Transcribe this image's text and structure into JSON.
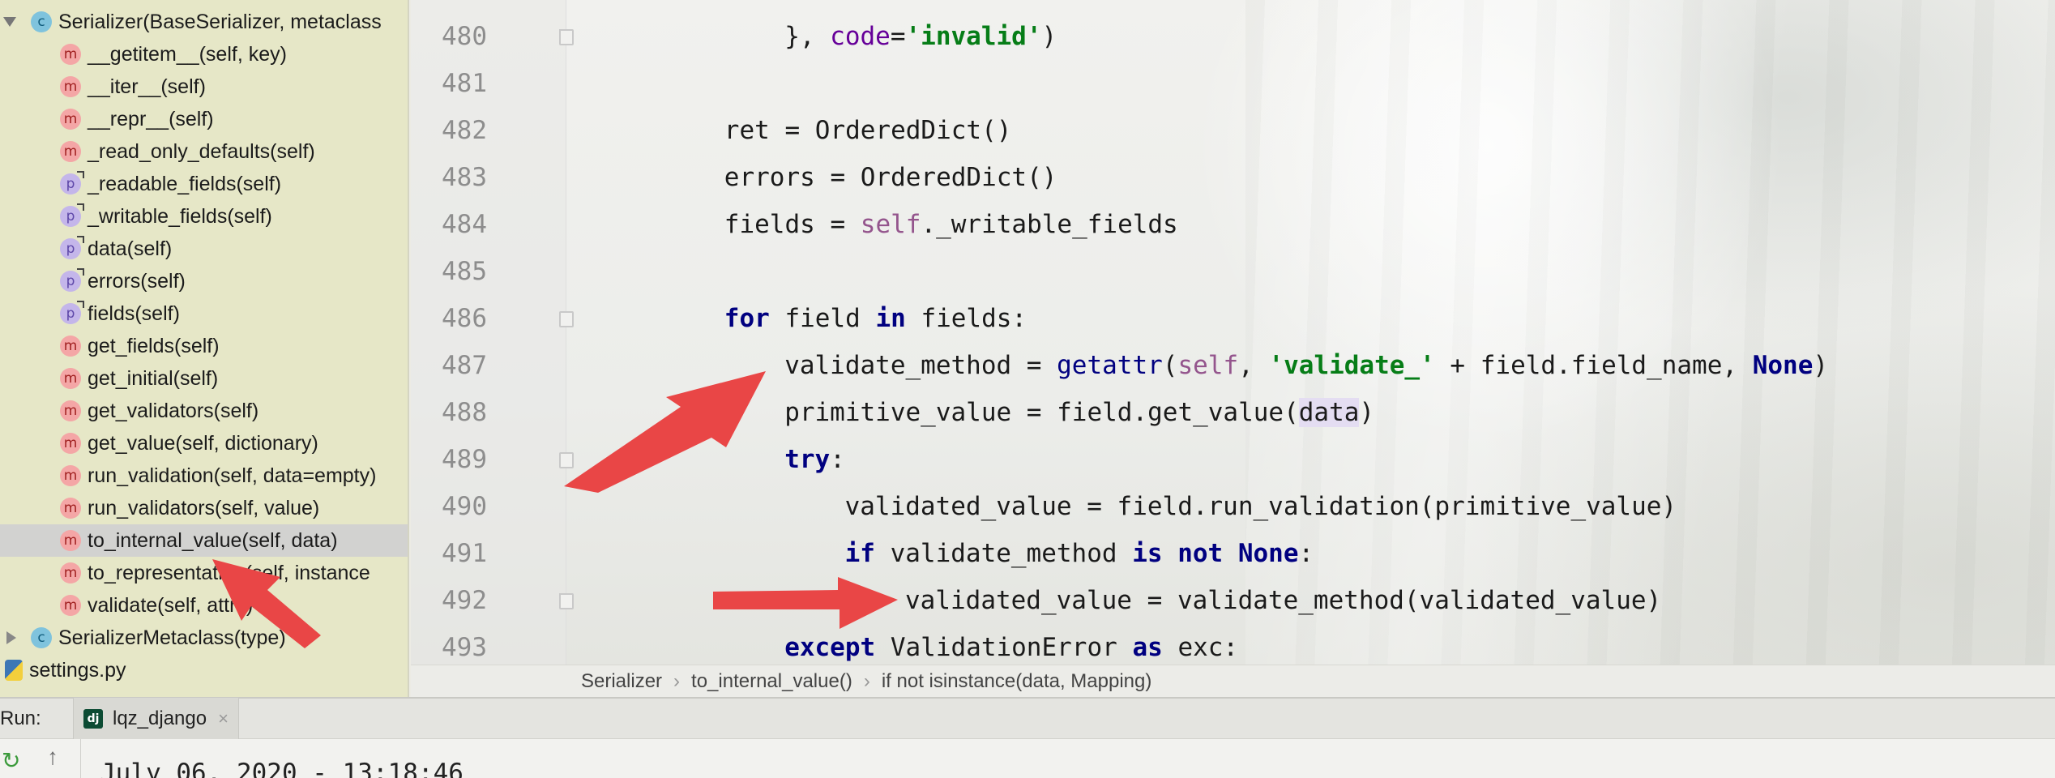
{
  "structure": {
    "items": [
      {
        "kind": "c",
        "label": "Serializer(BaseSerializer, metaclass",
        "expand": "down",
        "indent": 0
      },
      {
        "kind": "m",
        "label": "__getitem__(self, key)",
        "indent": 1
      },
      {
        "kind": "m",
        "label": "__iter__(self)",
        "indent": 1
      },
      {
        "kind": "m",
        "label": "__repr__(self)",
        "indent": 1
      },
      {
        "kind": "m",
        "label": "_read_only_defaults(self)",
        "indent": 1
      },
      {
        "kind": "p",
        "label": "_readable_fields(self)",
        "indent": 1
      },
      {
        "kind": "p",
        "label": "_writable_fields(self)",
        "indent": 1
      },
      {
        "kind": "p",
        "label": "data(self)",
        "indent": 1
      },
      {
        "kind": "p",
        "label": "errors(self)",
        "indent": 1
      },
      {
        "kind": "p",
        "label": "fields(self)",
        "indent": 1
      },
      {
        "kind": "m",
        "label": "get_fields(self)",
        "indent": 1
      },
      {
        "kind": "m",
        "label": "get_initial(self)",
        "indent": 1
      },
      {
        "kind": "m",
        "label": "get_validators(self)",
        "indent": 1
      },
      {
        "kind": "m",
        "label": "get_value(self, dictionary)",
        "indent": 1
      },
      {
        "kind": "m",
        "label": "run_validation(self, data=empty)",
        "indent": 1
      },
      {
        "kind": "m",
        "label": "run_validators(self, value)",
        "indent": 1
      },
      {
        "kind": "m",
        "label": "to_internal_value(self, data)",
        "indent": 1,
        "selected": true
      },
      {
        "kind": "m",
        "label": "to_representation(self, instance",
        "indent": 1
      },
      {
        "kind": "m",
        "label": "validate(self, attrs)",
        "indent": 1
      },
      {
        "kind": "c",
        "label": "SerializerMetaclass(type)",
        "expand": "right",
        "indent": 0
      },
      {
        "kind": "file",
        "label": "settings.py",
        "indent": -1
      }
    ]
  },
  "badge_letters": {
    "m": "m",
    "p": "p",
    "c": "c"
  },
  "editor": {
    "lines": [
      {
        "n": "480",
        "fold": "up",
        "indent": 6,
        "tokens": [
          [
            "}, ",
            ""
          ],
          [
            "code",
            "kwarg"
          ],
          [
            "=",
            ""
          ],
          [
            "'invalid'",
            "str"
          ],
          [
            ")",
            ""
          ]
        ]
      },
      {
        "n": "481",
        "indent": 0,
        "tokens": []
      },
      {
        "n": "482",
        "indent": 4,
        "tokens": [
          [
            "ret = OrderedDict()",
            ""
          ]
        ]
      },
      {
        "n": "483",
        "indent": 4,
        "tokens": [
          [
            "errors = OrderedDict()",
            ""
          ]
        ]
      },
      {
        "n": "484",
        "indent": 4,
        "tokens": [
          [
            "fields = ",
            ""
          ],
          [
            "self",
            "slf"
          ],
          [
            "._writable_fields",
            ""
          ]
        ]
      },
      {
        "n": "485",
        "indent": 0,
        "tokens": []
      },
      {
        "n": "486",
        "fold": "down",
        "indent": 4,
        "tokens": [
          [
            "for",
            "kw"
          ],
          [
            " field ",
            ""
          ],
          [
            "in",
            "kw"
          ],
          [
            " fields:",
            ""
          ]
        ]
      },
      {
        "n": "487",
        "indent": 6,
        "tokens": [
          [
            "validate_method = ",
            ""
          ],
          [
            "getattr",
            "bi"
          ],
          [
            "(",
            ""
          ],
          [
            "self",
            "slf"
          ],
          [
            ", ",
            ""
          ],
          [
            "'validate_'",
            "str"
          ],
          [
            " + field.field_name, ",
            ""
          ],
          [
            "None",
            "kw"
          ],
          [
            ")",
            ""
          ]
        ]
      },
      {
        "n": "488",
        "indent": 6,
        "tokens": [
          [
            "primitive_value = field.get_value(",
            ""
          ],
          [
            "data",
            "hl"
          ],
          [
            ")",
            ""
          ]
        ]
      },
      {
        "n": "489",
        "fold": "down",
        "indent": 6,
        "tokens": [
          [
            "try",
            "kw"
          ],
          [
            ":",
            ""
          ]
        ]
      },
      {
        "n": "490",
        "indent": 8,
        "tokens": [
          [
            "validated_value = field.run_validation(primitive_value)",
            ""
          ]
        ]
      },
      {
        "n": "491",
        "indent": 8,
        "tokens": [
          [
            "if",
            "kw"
          ],
          [
            " validate_method ",
            ""
          ],
          [
            "is not None",
            "kw"
          ],
          [
            ":",
            ""
          ]
        ]
      },
      {
        "n": "492",
        "fold": "up",
        "indent": 10,
        "tokens": [
          [
            "validated_value = validate_method(validated_value)",
            ""
          ]
        ]
      },
      {
        "n": "493",
        "indent": 6,
        "tokens": [
          [
            "except",
            "kw"
          ],
          [
            " ValidationError ",
            ""
          ],
          [
            "as",
            "kw"
          ],
          [
            " exc:",
            ""
          ]
        ]
      }
    ]
  },
  "breadcrumb": {
    "items": [
      "Serializer",
      "to_internal_value()",
      "if not isinstance(data, Mapping)"
    ],
    "separator": "›"
  },
  "run": {
    "label": "Run:",
    "tab_label": "lqz_django",
    "tab_icon": "dj",
    "close": "×"
  },
  "console": {
    "text": "July 06, 2020 - 13:18:46",
    "rerun_icon": "↻",
    "up_icon": "↑"
  },
  "colors": {
    "arrow": "#e94646",
    "structure_bg": "#e6e7c7",
    "selected_row": "#d2d2d0"
  }
}
